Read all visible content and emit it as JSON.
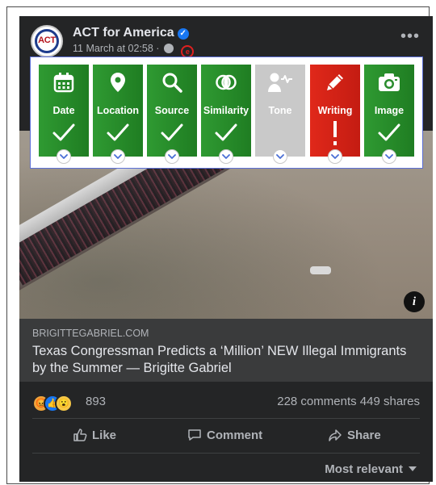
{
  "post": {
    "page_name": "ACT for America",
    "avatar_text": "ACT",
    "timestamp": "11 March at 02:58 ·",
    "more_label": "•••"
  },
  "overlay": {
    "tiles": [
      {
        "label": "Date",
        "status": "check",
        "color": "#2f9a32",
        "icon": "calendar-icon"
      },
      {
        "label": "Location",
        "status": "check",
        "color": "#2f9a32",
        "icon": "map-pin-icon"
      },
      {
        "label": "Source",
        "status": "check",
        "color": "#2f9a32",
        "icon": "magnifier-icon"
      },
      {
        "label": "Similarity",
        "status": "check",
        "color": "#2f9a32",
        "icon": "overlap-circles-icon"
      },
      {
        "label": "Tone",
        "status": "none",
        "color": "#c9c9c9",
        "icon": "person-voice-icon"
      },
      {
        "label": "Writing",
        "status": "warning",
        "color": "#e0281a",
        "icon": "pencil-icon"
      },
      {
        "label": "Image",
        "status": "check",
        "color": "#2f9a32",
        "icon": "camera-icon"
      }
    ]
  },
  "link": {
    "domain": "BRIGITTEGABRIEL.COM",
    "headline": "Texas Congressman Predicts a ‘Million’ NEW Illegal Immigrants by the Summer — Brigitte Gabriel",
    "info_label": "i"
  },
  "engagement": {
    "reaction_count": "893",
    "comments_shares": "228 comments  449 shares"
  },
  "actions": {
    "like": "Like",
    "comment": "Comment",
    "share": "Share"
  },
  "sort": {
    "label": "Most relevant"
  }
}
